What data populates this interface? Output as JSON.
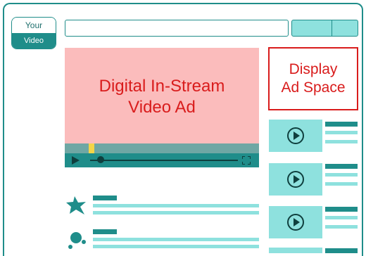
{
  "logo": {
    "line1": "Your",
    "line2": "Video"
  },
  "video_ad": {
    "text_line1": "Digital In-Stream",
    "text_line2": "Video Ad",
    "progress_fraction": 0.14
  },
  "display_ad": {
    "line1": "Display",
    "line2": "Ad Space"
  },
  "icons": [
    "play-icon",
    "fullscreen-icon",
    "star-icon",
    "circles-icon"
  ],
  "colors": {
    "teal": "#1f8d8a",
    "light_teal": "#8ee1de",
    "pink": "#fbbcbc",
    "red": "#d91c1c",
    "yellow": "#f3d548"
  }
}
